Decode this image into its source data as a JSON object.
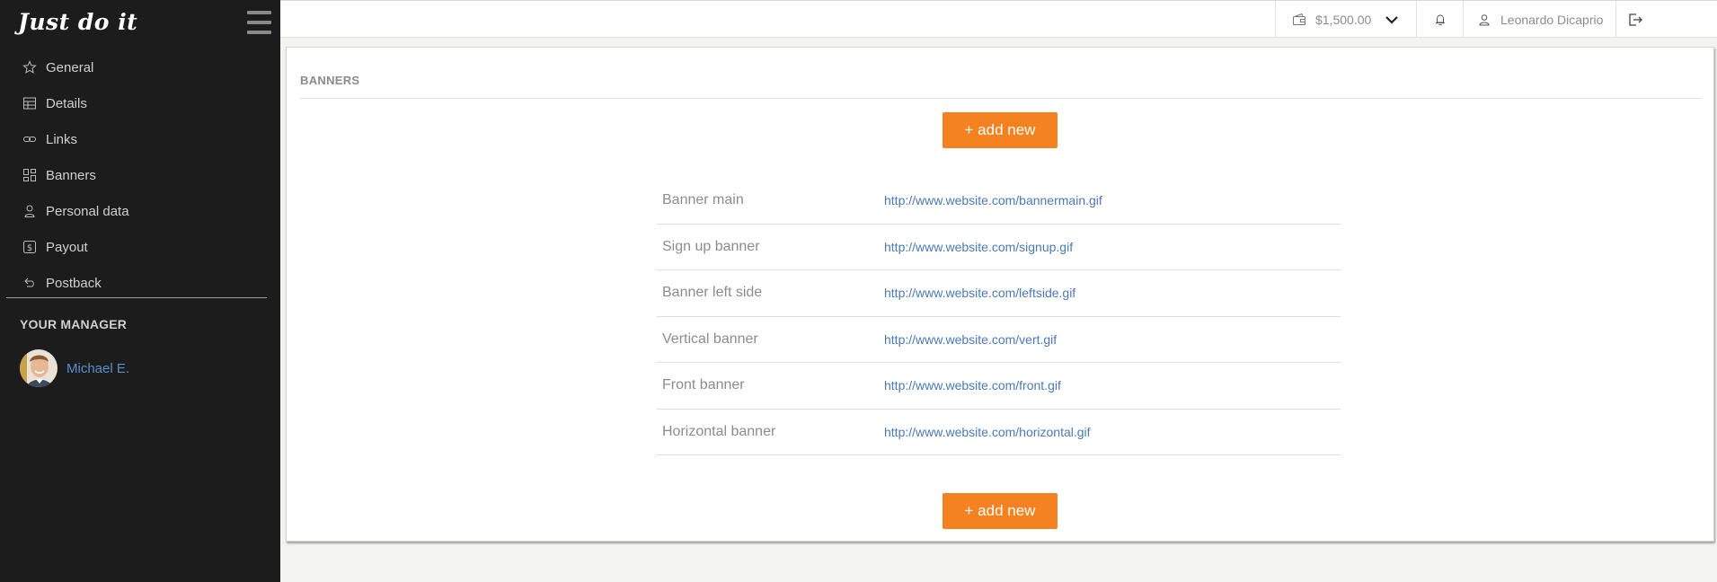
{
  "brand": "Just do it",
  "sidebar": {
    "items": [
      {
        "label": "General",
        "icon": "star-icon"
      },
      {
        "label": "Details",
        "icon": "details-icon"
      },
      {
        "label": "Links",
        "icon": "link-icon"
      },
      {
        "label": "Banners",
        "icon": "grid-icon"
      },
      {
        "label": "Personal data",
        "icon": "user-icon"
      },
      {
        "label": "Payout",
        "icon": "dollar-icon"
      },
      {
        "label": "Postback",
        "icon": "undo-icon"
      }
    ],
    "manager_title": "YOUR MANAGER",
    "manager_name": "Michael E."
  },
  "topbar": {
    "balance": "$1,500.00",
    "user_name": "Leonardo Dicaprio"
  },
  "main": {
    "title": "BANNERS",
    "add_button": "+ add new",
    "banners": [
      {
        "name": "Banner main",
        "url": "http://www.website.com/bannermain.gif"
      },
      {
        "name": "Sign up banner",
        "url": "http://www.website.com/signup.gif"
      },
      {
        "name": "Banner left side",
        "url": "http://www.website.com/leftside.gif"
      },
      {
        "name": "Vertical banner",
        "url": "http://www.website.com/vert.gif"
      },
      {
        "name": "Front banner",
        "url": "http://www.website.com/front.gif"
      },
      {
        "name": "Horizontal banner",
        "url": "http://www.website.com/horizontal.gif"
      }
    ]
  },
  "colors": {
    "sidebar_bg": "#1c1c1c",
    "accent_orange": "#f48220",
    "link_blue": "#4a7ab7"
  }
}
